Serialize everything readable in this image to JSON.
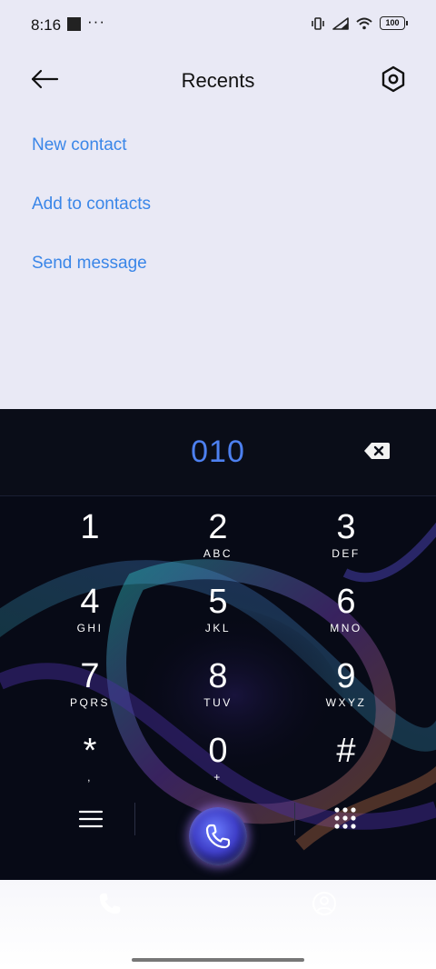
{
  "status_bar": {
    "time": "8:16",
    "dots": "···",
    "battery": "100"
  },
  "header": {
    "title": "Recents"
  },
  "actions": {
    "new_contact": "New contact",
    "add_to_contacts": "Add to contacts",
    "send_message": "Send message"
  },
  "dialer": {
    "number": "010",
    "keys": [
      {
        "digit": "1",
        "letters": ""
      },
      {
        "digit": "2",
        "letters": "ABC"
      },
      {
        "digit": "3",
        "letters": "DEF"
      },
      {
        "digit": "4",
        "letters": "GHI"
      },
      {
        "digit": "5",
        "letters": "JKL"
      },
      {
        "digit": "6",
        "letters": "MNO"
      },
      {
        "digit": "7",
        "letters": "PQRS"
      },
      {
        "digit": "8",
        "letters": "TUV"
      },
      {
        "digit": "9",
        "letters": "WXYZ"
      },
      {
        "digit": "*",
        "letters": ","
      },
      {
        "digit": "0",
        "letters": "+"
      },
      {
        "digit": "#",
        "letters": ""
      }
    ]
  },
  "colors": {
    "accent": "#3a86e8",
    "dialed_number": "#4d80f0",
    "dialer_bg": "#05070f"
  },
  "icons": {
    "back": "back-arrow-icon",
    "settings": "settings-hexagon-icon",
    "backspace": "backspace-icon",
    "menu": "menu-icon",
    "keypad": "keypad-grid-icon",
    "call": "phone-icon",
    "tab_phone": "phone-icon",
    "tab_contacts": "person-icon"
  }
}
